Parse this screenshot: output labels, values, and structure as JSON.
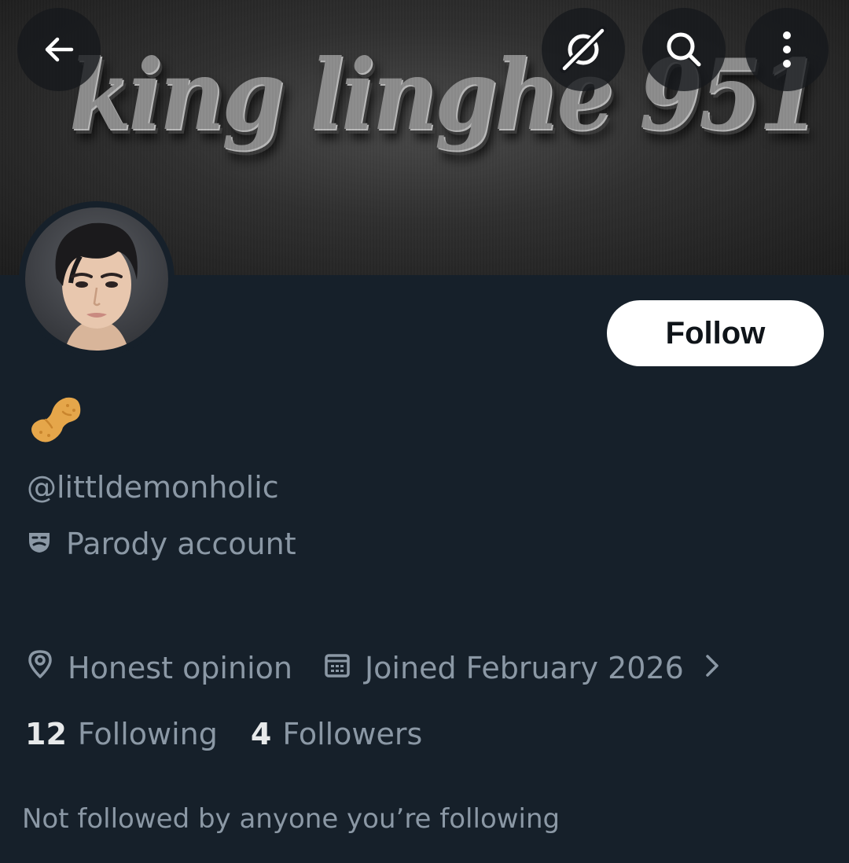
{
  "banner": {
    "text": "king linghe 951"
  },
  "header": {
    "back_icon": "arrow-left-icon",
    "grok_icon": "grok-icon",
    "search_icon": "search-icon",
    "more_icon": "more-vertical-icon"
  },
  "profile": {
    "display_name_emoji": "peanut-emoji",
    "follow_label": "Follow",
    "handle": "@littldemonholic",
    "parody_label": "Parody account",
    "location": "Honest opinion",
    "joined": "Joined February 2026",
    "following_count": "12",
    "following_label": "Following",
    "followers_count": "4",
    "followers_label": "Followers",
    "mutuals_note": "Not followed by anyone you’re following"
  },
  "colors": {
    "background": "#16202a",
    "muted_text": "#8b98a5",
    "primary_text": "#e7e9ea",
    "follow_button_bg": "#ffffff",
    "peanut": "#e5a64a"
  }
}
